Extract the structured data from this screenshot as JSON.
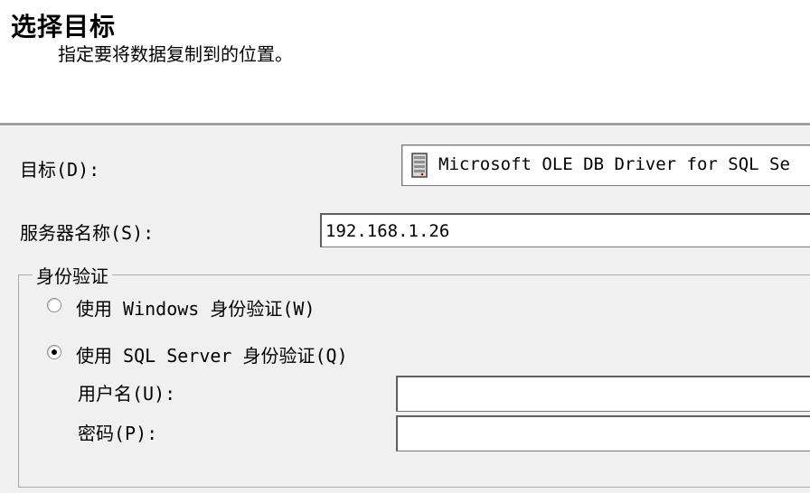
{
  "header": {
    "title": "选择目标",
    "subtitle": "指定要将数据复制到的位置。"
  },
  "form": {
    "destination_label": "目标(D):",
    "destination_value": "Microsoft OLE DB Driver for SQL Se",
    "destination_icon": "database-icon",
    "server_label": "服务器名称(S):",
    "server_value": "192.168.1.26"
  },
  "auth": {
    "group_title": "身份验证",
    "windows_option": "使用 Windows 身份验证(W)",
    "sql_option": "使用 SQL Server 身份验证(Q)",
    "selected": "sql",
    "username_label": "用户名(U):",
    "username_value": "",
    "password_label": "密码(P):",
    "password_value": ""
  }
}
